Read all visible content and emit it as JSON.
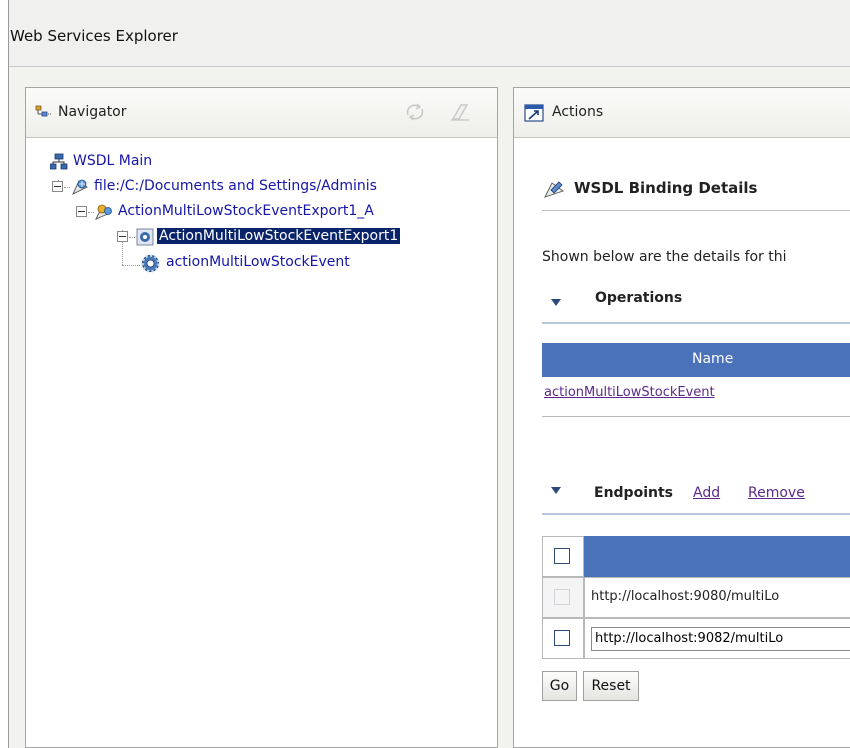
{
  "window": {
    "title": "Web Services Explorer"
  },
  "navigator": {
    "title": "Navigator",
    "tree": [
      {
        "label": "WSDL Main",
        "icon": "wsdl-main-icon"
      },
      {
        "label": "file:/C:/Documents and Settings/Adminis",
        "icon": "wsdl-file-icon"
      },
      {
        "label": "ActionMultiLowStockEventExport1_A",
        "icon": "service-icon"
      },
      {
        "label": "ActionMultiLowStockEventExport1",
        "icon": "binding-icon",
        "selected": true
      },
      {
        "label": "actionMultiLowStockEvent",
        "icon": "operation-gear-icon"
      }
    ]
  },
  "actions": {
    "title": "Actions",
    "section_title": "WSDL Binding Details",
    "description": "Shown below are the details for thi",
    "operations": {
      "title": "Operations",
      "column_name": "Name",
      "rows": [
        "actionMultiLowStockEvent"
      ]
    },
    "endpoints": {
      "title": "Endpoints",
      "add_label": "Add",
      "remove_label": "Remove",
      "rows": [
        "http://localhost:9080/multiLo",
        "http://localhost:9082/multiLo"
      ]
    },
    "go_label": "Go",
    "reset_label": "Reset"
  },
  "colors": {
    "table_header": "#4a72b8",
    "selection": "#0a246a",
    "link": "#5b2a8a",
    "tree_text": "#1515a8"
  }
}
